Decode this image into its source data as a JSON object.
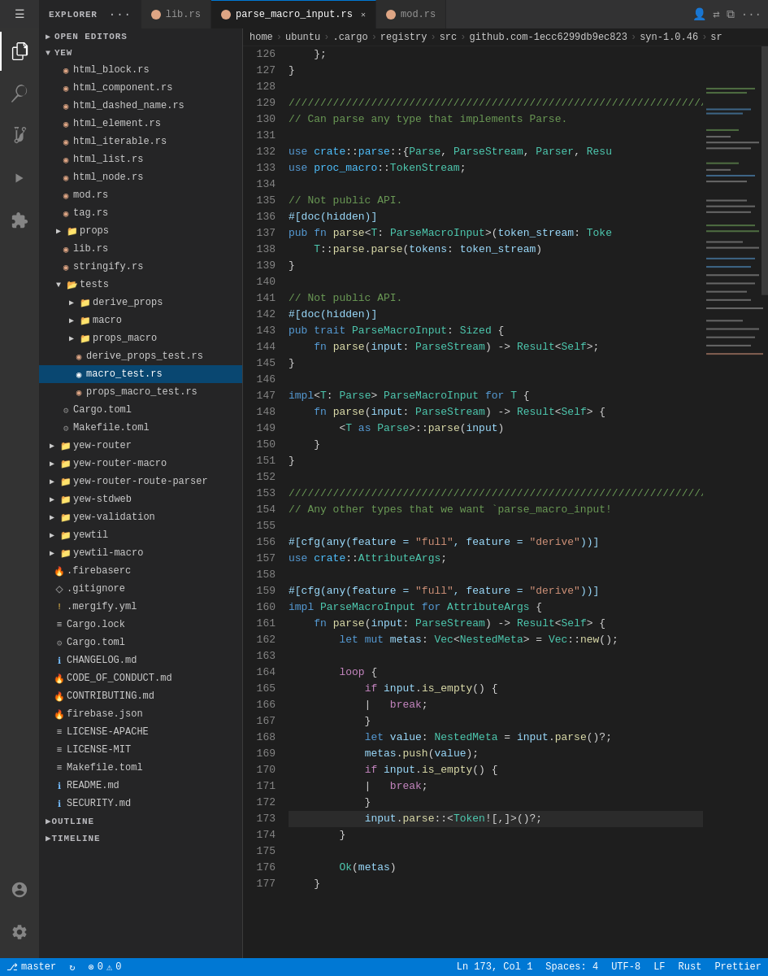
{
  "titlebar": {
    "explorer_label": "EXPLORER",
    "more_icon": "···",
    "tabs": [
      {
        "id": "lib",
        "icon": "rust",
        "label": "lib.rs",
        "active": false,
        "modified": false
      },
      {
        "id": "parse_macro_input",
        "icon": "rust",
        "label": "parse_macro_input.rs",
        "active": true,
        "modified": false,
        "closeable": true
      },
      {
        "id": "mod",
        "icon": "rust",
        "label": "mod.rs",
        "active": false
      }
    ]
  },
  "breadcrumb": {
    "items": [
      "home",
      "ubuntu",
      ".cargo",
      "registry",
      "src",
      "github.com-1ecc6299db9ec823",
      "syn-1.0.46",
      "sr"
    ]
  },
  "sidebar": {
    "open_editors_label": "OPEN EDITORS",
    "yew_label": "YEW",
    "files": [
      {
        "name": "html_block.rs",
        "type": "rust",
        "indent": 1
      },
      {
        "name": "html_component.rs",
        "type": "rust",
        "indent": 1
      },
      {
        "name": "html_dashed_name.rs",
        "type": "rust",
        "indent": 1
      },
      {
        "name": "html_element.rs",
        "type": "rust",
        "indent": 1
      },
      {
        "name": "html_iterable.rs",
        "type": "rust",
        "indent": 1
      },
      {
        "name": "html_list.rs",
        "type": "rust",
        "indent": 1
      },
      {
        "name": "html_node.rs",
        "type": "rust",
        "indent": 1
      },
      {
        "name": "mod.rs",
        "type": "rust",
        "indent": 1
      },
      {
        "name": "tag.rs",
        "type": "rust",
        "indent": 1
      },
      {
        "name": "props",
        "type": "folder",
        "indent": 1,
        "collapsed": true
      },
      {
        "name": "lib.rs",
        "type": "rust",
        "indent": 1
      },
      {
        "name": "stringify.rs",
        "type": "rust",
        "indent": 1
      },
      {
        "name": "tests",
        "type": "folder",
        "indent": 1,
        "collapsed": false
      },
      {
        "name": "derive_props",
        "type": "folder",
        "indent": 2,
        "collapsed": true
      },
      {
        "name": "macro",
        "type": "folder",
        "indent": 2,
        "collapsed": true
      },
      {
        "name": "props_macro",
        "type": "folder",
        "indent": 2,
        "collapsed": true
      },
      {
        "name": "derive_props_test.rs",
        "type": "rust",
        "indent": 2
      },
      {
        "name": "macro_test.rs",
        "type": "rust",
        "indent": 2,
        "active": true
      },
      {
        "name": "props_macro_test.rs",
        "type": "rust",
        "indent": 2
      },
      {
        "name": "Cargo.toml",
        "type": "toml",
        "indent": 1
      },
      {
        "name": "Makefile.toml",
        "type": "toml",
        "indent": 1
      },
      {
        "name": "yew-router",
        "type": "folder",
        "indent": 0,
        "collapsed": true
      },
      {
        "name": "yew-router-macro",
        "type": "folder",
        "indent": 0,
        "collapsed": true
      },
      {
        "name": "yew-router-route-parser",
        "type": "folder",
        "indent": 0,
        "collapsed": true
      },
      {
        "name": "yew-stdweb",
        "type": "folder",
        "indent": 0,
        "collapsed": true
      },
      {
        "name": "yew-validation",
        "type": "folder",
        "indent": 0,
        "collapsed": true
      },
      {
        "name": "yewtil",
        "type": "folder",
        "indent": 0,
        "collapsed": true
      },
      {
        "name": "yewtil-macro",
        "type": "folder",
        "indent": 0,
        "collapsed": true
      },
      {
        "name": ".firebaserc",
        "type": "fire",
        "indent": 0
      },
      {
        "name": ".gitignore",
        "type": "dot",
        "indent": 0
      },
      {
        "name": ".mergify.yml",
        "type": "exclaim",
        "indent": 0
      },
      {
        "name": "Cargo.lock",
        "type": "lock",
        "indent": 0
      },
      {
        "name": "Cargo.toml",
        "type": "toml",
        "indent": 0
      },
      {
        "name": "CHANGELOG.md",
        "type": "info",
        "indent": 0
      },
      {
        "name": "CODE_OF_CONDUCT.md",
        "type": "fire2",
        "indent": 0
      },
      {
        "name": "CONTRIBUTING.md",
        "type": "fire2",
        "indent": 0
      },
      {
        "name": "firebase.json",
        "type": "fire",
        "indent": 0
      },
      {
        "name": "LICENSE-APACHE",
        "type": "list",
        "indent": 0
      },
      {
        "name": "LICENSE-MIT",
        "type": "list",
        "indent": 0
      },
      {
        "name": "Makefile.toml",
        "type": "list",
        "indent": 0
      },
      {
        "name": "README.md",
        "type": "info",
        "indent": 0
      },
      {
        "name": "SECURITY.md",
        "type": "info",
        "indent": 0
      }
    ],
    "outline_label": "OUTLINE",
    "timeline_label": "TIMELINE"
  },
  "editor": {
    "filename": "parse_macro_input.rs",
    "lines": [
      {
        "num": 126,
        "code": "    };"
      },
      {
        "num": 127,
        "code": "}"
      },
      {
        "num": 128,
        "code": ""
      },
      {
        "num": 129,
        "code": "///////////////////////////////////////////////",
        "type": "comment"
      },
      {
        "num": 130,
        "code": "// Can parse any type that implements Parse.",
        "type": "comment"
      },
      {
        "num": 131,
        "code": ""
      },
      {
        "num": 132,
        "code": "use crate::parse::{Parse, ParseStream, Parser, Resu",
        "type": "code"
      },
      {
        "num": 133,
        "code": "use proc_macro::TokenStream;",
        "type": "code"
      },
      {
        "num": 134,
        "code": ""
      },
      {
        "num": 135,
        "code": "// Not public API.",
        "type": "comment"
      },
      {
        "num": 136,
        "code": "#[doc(hidden)]",
        "type": "attr_line"
      },
      {
        "num": 137,
        "code": "pub fn parse<T: ParseMacroInput>(token_stream: Toke",
        "type": "code"
      },
      {
        "num": 138,
        "code": "    T::parse.parse(tokens: token_stream)",
        "type": "code"
      },
      {
        "num": 139,
        "code": "}"
      },
      {
        "num": 140,
        "code": ""
      },
      {
        "num": 141,
        "code": "// Not public API.",
        "type": "comment"
      },
      {
        "num": 142,
        "code": "#[doc(hidden)]",
        "type": "attr_line"
      },
      {
        "num": 143,
        "code": "pub trait ParseMacroInput: Sized {",
        "type": "code"
      },
      {
        "num": 144,
        "code": "    fn parse(input: ParseStream) -> Result<Self>;",
        "type": "code"
      },
      {
        "num": 145,
        "code": "}"
      },
      {
        "num": 146,
        "code": ""
      },
      {
        "num": 147,
        "code": "impl<T: Parse> ParseMacroInput for T {",
        "type": "code"
      },
      {
        "num": 148,
        "code": "    fn parse(input: ParseStream) -> Result<Self> {",
        "type": "code"
      },
      {
        "num": 149,
        "code": "        <T as Parse>::parse(input)",
        "type": "code"
      },
      {
        "num": 150,
        "code": "    }"
      },
      {
        "num": 151,
        "code": "}"
      },
      {
        "num": 152,
        "code": ""
      },
      {
        "num": 153,
        "code": "///////////////////////////////////////////////",
        "type": "comment"
      },
      {
        "num": 154,
        "code": "// Any other types that we want `parse_macro_input!",
        "type": "comment"
      },
      {
        "num": 155,
        "code": ""
      },
      {
        "num": 156,
        "code": "#[cfg(any(feature = \"full\", feature = \"derive\"))]",
        "type": "attr_line"
      },
      {
        "num": 157,
        "code": "use crate::AttributeArgs;",
        "type": "code"
      },
      {
        "num": 158,
        "code": ""
      },
      {
        "num": 159,
        "code": "#[cfg(any(feature = \"full\", feature = \"derive\"))]",
        "type": "attr_line"
      },
      {
        "num": 160,
        "code": "impl ParseMacroInput for AttributeArgs {",
        "type": "code"
      },
      {
        "num": 161,
        "code": "    fn parse(input: ParseStream) -> Result<Self> {",
        "type": "code"
      },
      {
        "num": 162,
        "code": "        let mut metas: Vec<NestedMeta> = Vec::new();",
        "type": "code"
      },
      {
        "num": 163,
        "code": ""
      },
      {
        "num": 164,
        "code": "        loop {",
        "type": "code"
      },
      {
        "num": 165,
        "code": "            if input.is_empty() {",
        "type": "code"
      },
      {
        "num": 166,
        "code": "            |   break;",
        "type": "code"
      },
      {
        "num": 167,
        "code": "            }",
        "type": "code"
      },
      {
        "num": 168,
        "code": "            let value: NestedMeta = input.parse()?;",
        "type": "code"
      },
      {
        "num": 169,
        "code": "            metas.push(value);",
        "type": "code"
      },
      {
        "num": 170,
        "code": "            if input.is_empty() {",
        "type": "code"
      },
      {
        "num": 171,
        "code": "            |   break;",
        "type": "code"
      },
      {
        "num": 172,
        "code": "            }",
        "type": "code"
      },
      {
        "num": 173,
        "code": "            input.parse::<Token![,]>()?;",
        "type": "code"
      },
      {
        "num": 174,
        "code": "        }"
      },
      {
        "num": 175,
        "code": ""
      },
      {
        "num": 176,
        "code": "        Ok(metas)"
      },
      {
        "num": 177,
        "code": "    }"
      }
    ]
  },
  "status_bar": {
    "branch_icon": "⎇",
    "branch": "master",
    "sync_icon": "↻",
    "errors": "0",
    "warnings": "0",
    "right_items": [
      "Ln 173, Col 1",
      "Spaces: 4",
      "UTF-8",
      "LF",
      "Rust",
      "Prettier"
    ]
  }
}
